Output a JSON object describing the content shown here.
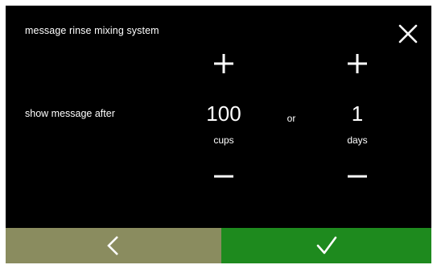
{
  "screen": {
    "title": "message rinse mixing system",
    "close_icon": "close-icon"
  },
  "setting": {
    "label": "show message after",
    "separator": "or",
    "cups": {
      "value": "100",
      "unit": "cups",
      "increment_icon": "plus-icon",
      "decrement_icon": "minus-icon"
    },
    "days": {
      "value": "1",
      "unit": "days",
      "increment_icon": "plus-icon",
      "decrement_icon": "minus-icon"
    }
  },
  "footer": {
    "back_icon": "chevron-left-icon",
    "confirm_icon": "checkmark-icon",
    "back_color": "#8a8c5f",
    "confirm_color": "#1e8a1e"
  },
  "colors": {
    "background": "#000000",
    "text": "#ffffff"
  }
}
